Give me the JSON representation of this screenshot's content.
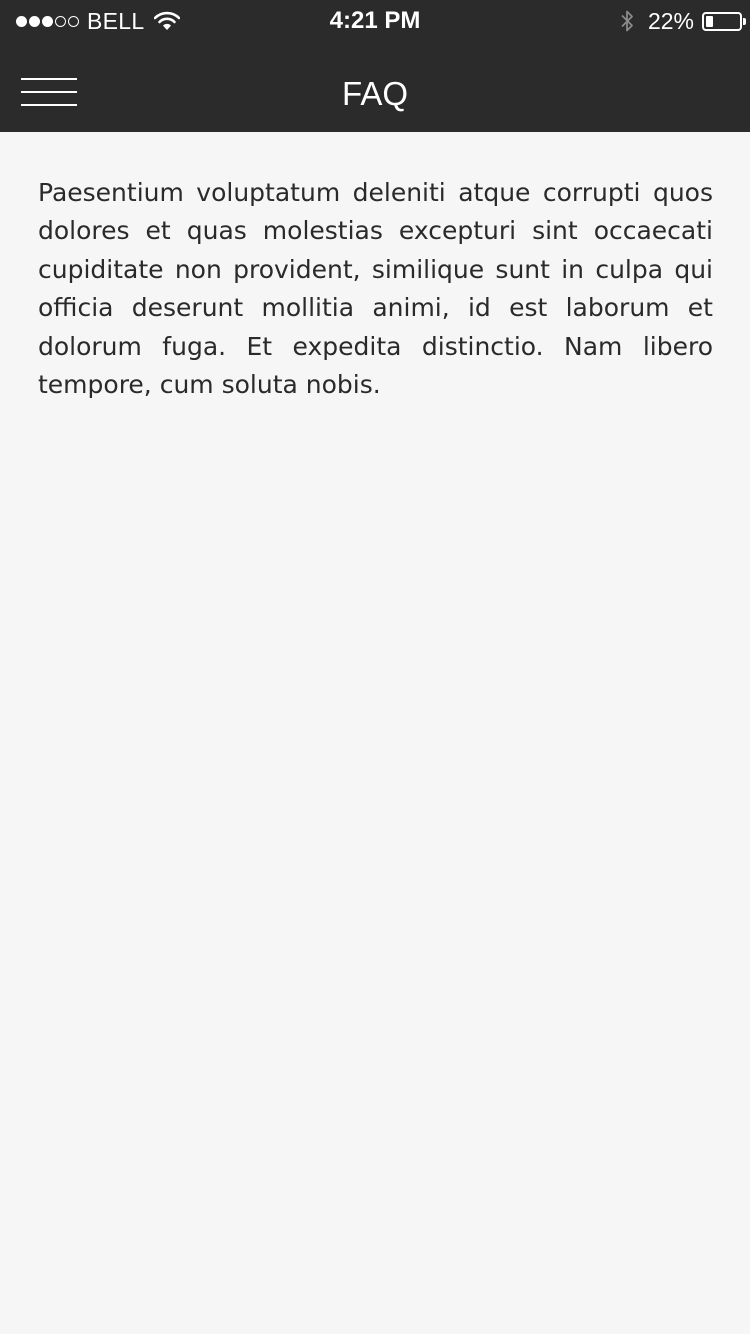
{
  "status_bar": {
    "signal_full": 3,
    "signal_total": 5,
    "carrier": "BELL",
    "time": "4:21 PM",
    "battery": "22%",
    "battery_level": 0.22,
    "icons": [
      "wifi-icon",
      "bluetooth-icon",
      "battery-icon"
    ]
  },
  "nav": {
    "title": "FAQ",
    "menu_icon": "hamburger-menu-icon"
  },
  "content": {
    "body": "Paesentium voluptatum deleniti atque corrupti quos dolores et quas molestias excepturi sint occaecati cupiditate non provident, similique sunt in culpa qui officia deserunt mollitia animi, id est laborum et dolorum fuga. Et expedita distinctio. Nam libero tempore, cum soluta nobis."
  },
  "colors": {
    "header_bg": "#2b2b2b",
    "page_bg": "#f6f6f6",
    "text": "#2a2a2a"
  }
}
